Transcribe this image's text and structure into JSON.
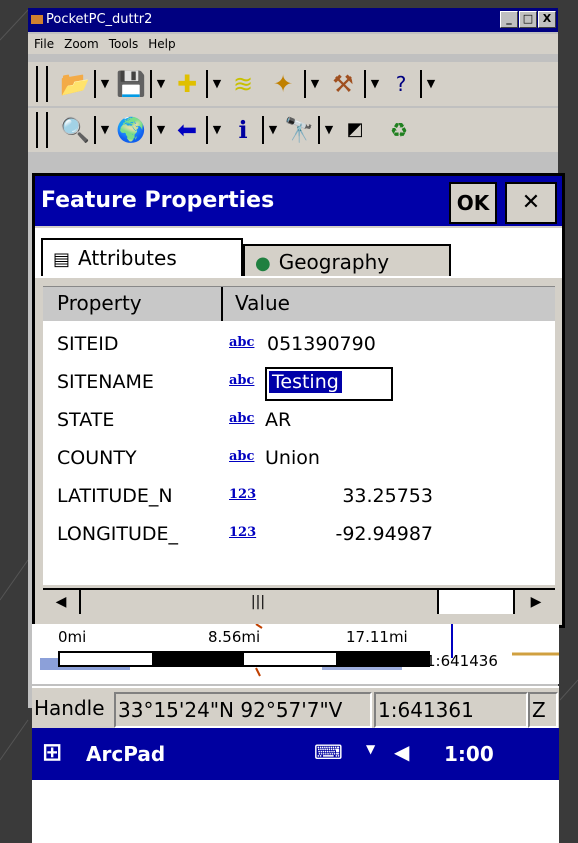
{
  "window": {
    "title": "PocketPC_duttr2"
  },
  "window_buttons": [
    "_",
    "□",
    "X"
  ],
  "menu": {
    "items": [
      "File",
      "Zoom",
      "Tools",
      "Help"
    ]
  },
  "toolbar1": {
    "icons": [
      "open-folder-icon",
      "save-icon",
      "add-layer-icon",
      "layers-icon",
      "gps-icon",
      "tools-icon",
      "help-icon"
    ]
  },
  "toolbar2": {
    "icons": [
      "zoom-in-icon",
      "globe-icon",
      "back-arrow-icon",
      "info-icon",
      "find-icon",
      "select-icon",
      "refresh-icon"
    ]
  },
  "dialog": {
    "title": "Feature Properties",
    "ok_label": "OK",
    "close_label": "✕",
    "tabs": [
      {
        "label": "Attributes"
      },
      {
        "label": "Geography"
      }
    ],
    "columns": {
      "property": "Property",
      "value": "Value"
    },
    "type_text": "abc",
    "type_num": "123",
    "rows": [
      {
        "property": "SITEID",
        "value": "051390790"
      },
      {
        "property": "SITENAME",
        "value": "Testing"
      },
      {
        "property": "STATE",
        "value": "AR"
      },
      {
        "property": "COUNTY",
        "value": "Union"
      },
      {
        "property": "LATITUDE_N",
        "value": "33.25753"
      },
      {
        "property": "LONGITUDE_",
        "value": "-92.94987"
      }
    ],
    "scroll_thumb": "|||"
  },
  "map": {
    "scale_labels": [
      "0mi",
      "8.56mi",
      "17.11mi"
    ],
    "scale_ratio": "1:641436"
  },
  "status": {
    "tool": "Handle",
    "coords": "33°15'24\"N 92°57'7\"V",
    "scale": "1:641361",
    "extra": "Z"
  },
  "taskbar": {
    "app": "ArcPad",
    "time": "1:00"
  }
}
